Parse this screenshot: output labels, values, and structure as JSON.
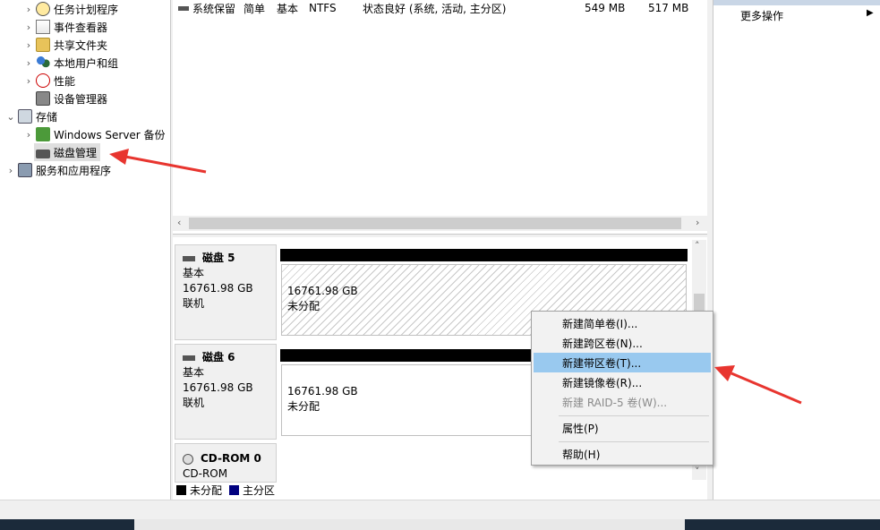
{
  "tree": {
    "items": [
      {
        "label": "任务计划程序",
        "icon": "clock-icon"
      },
      {
        "label": "事件查看器",
        "icon": "event-viewer-icon"
      },
      {
        "label": "共享文件夹",
        "icon": "shared-folder-icon"
      },
      {
        "label": "本地用户和组",
        "icon": "users-icon"
      },
      {
        "label": "性能",
        "icon": "performance-icon"
      },
      {
        "label": "设备管理器",
        "icon": "device-manager-icon"
      },
      {
        "label": "存储",
        "icon": "storage-icon"
      },
      {
        "label": "Windows Server 备份",
        "icon": "backup-icon"
      },
      {
        "label": "磁盘管理",
        "icon": "disk-management-icon"
      },
      {
        "label": "服务和应用程序",
        "icon": "services-icon"
      }
    ]
  },
  "volume_row": {
    "name": "系统保留",
    "layout": "简单",
    "type": "基本",
    "fs": "NTFS",
    "status": "状态良好 (系统, 活动, 主分区)",
    "capacity": "549 MB",
    "free": "517 MB"
  },
  "disks": [
    {
      "name": "磁盘 5",
      "type": "基本",
      "size": "16761.98 GB",
      "state": "联机",
      "part_size": "16761.98 GB",
      "part_status": "未分配"
    },
    {
      "name": "磁盘 6",
      "type": "基本",
      "size": "16761.98 GB",
      "state": "联机",
      "part_size": "16761.98 GB",
      "part_status": "未分配"
    },
    {
      "name": "CD-ROM 0",
      "type": "CD-ROM"
    }
  ],
  "legend": {
    "unallocated": "未分配",
    "primary": "主分区"
  },
  "actions": {
    "more": "更多操作"
  },
  "context_menu": {
    "items": [
      {
        "label": "新建简单卷(I)..."
      },
      {
        "label": "新建跨区卷(N)..."
      },
      {
        "label": "新建带区卷(T)..."
      },
      {
        "label": "新建镜像卷(R)..."
      },
      {
        "label": "新建 RAID-5 卷(W)..."
      },
      {
        "label": "属性(P)"
      },
      {
        "label": "帮助(H)"
      }
    ]
  },
  "colors": {
    "highlight": "#99c9ef",
    "primary_partition": "#00007f",
    "annotation": "#e8352f"
  }
}
